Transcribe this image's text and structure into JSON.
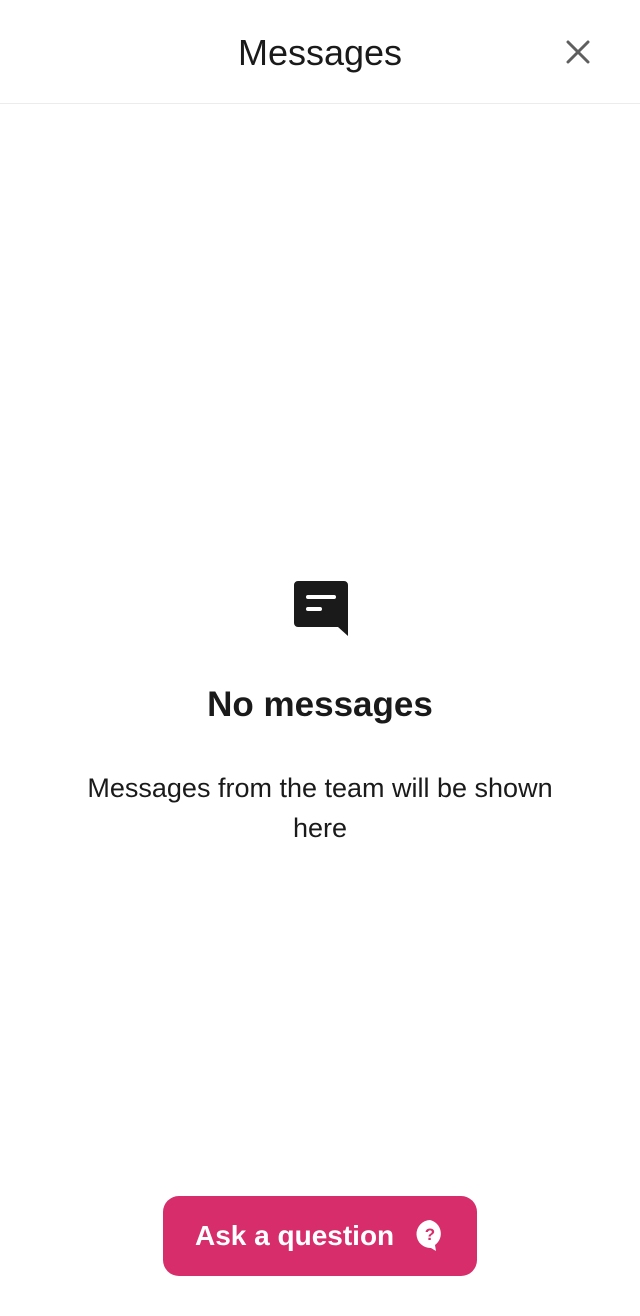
{
  "header": {
    "title": "Messages",
    "close_icon": "close-icon"
  },
  "empty_state": {
    "icon": "message-icon",
    "title": "No messages",
    "description": "Messages from the team will be shown here"
  },
  "ask_button": {
    "label": "Ask a question",
    "icon": "question-bubble-icon",
    "color": "#d82d6b"
  }
}
